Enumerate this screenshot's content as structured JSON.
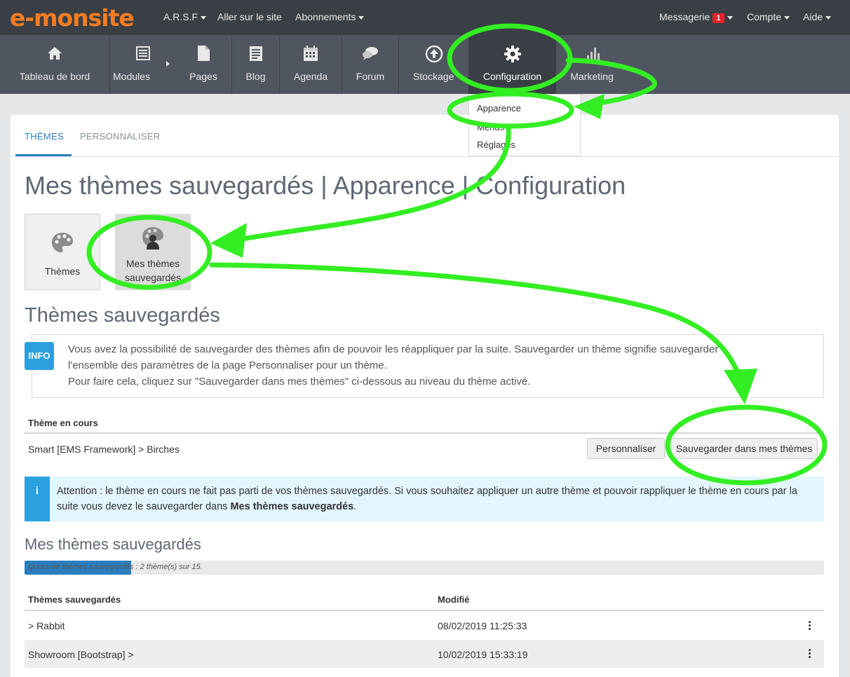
{
  "topbar": {
    "logo": "e-monsite",
    "site_menu": "A.R.S.F",
    "visit_site": "Aller sur le site",
    "subscriptions": "Abonnements",
    "messaging": "Messagerie",
    "messaging_count": "1",
    "account": "Compte",
    "help": "Aide"
  },
  "nav": {
    "dashboard": "Tableau de bord",
    "modules": "Modules",
    "pages": "Pages",
    "blog": "Blog",
    "agenda": "Agenda",
    "forum": "Forum",
    "storage": "Stockage",
    "configuration": "Configuration",
    "marketing": "Marketing"
  },
  "dropdown": {
    "items": [
      "Apparence",
      "Menus",
      "Réglages"
    ]
  },
  "tabs": {
    "themes": "THÈMES",
    "customize": "PERSONNALISER"
  },
  "page_title": "Mes thèmes sauvegardés | Apparence | Configuration",
  "tiles": {
    "themes": "Thèmes",
    "saved_line1": "Mes thèmes",
    "saved_line2": "sauvegardés"
  },
  "section_title": "Thèmes sauvegardés",
  "info": {
    "tag": "INFO",
    "line1": "Vous avez la possibilité de sauvegarder des thèmes afin de pouvoir les réappliquer par la suite. Sauvegarder un thème signifie sauvegarder",
    "line2": "l'ensemble des paramètres de la page Personnaliser pour un thème.",
    "line3": "Pour faire cela, cliquez sur \"Sauvegarder dans mes thèmes\" ci-dessous au niveau du thème activé."
  },
  "current_theme": {
    "header": "Thème en cours",
    "name": "Smart [EMS Framework] > Birches",
    "customize_button": "Personnaliser",
    "save_button": "Sauvegarder dans mes thèmes"
  },
  "alert": {
    "icon": "i",
    "text_part1": "Attention : le thème en cours ne fait pas parti de vos thèmes sauvegardés. Si vous souhaitez appliquer un autre thème et pouvoir rappliquer le thème en cours par la suite vous devez le sauvegarder dans ",
    "text_bold": "Mes thèmes sauvegardés",
    "text_part2": "."
  },
  "saved_section_title": "Mes thèmes sauvegardés",
  "quota": {
    "text": "Quota de thèmes sauvegardés : 2 thème(s) sur 15.",
    "fraction": 0.1333
  },
  "table": {
    "col1": "Thèmes sauvegardés",
    "col2": "Modifié",
    "rows": [
      {
        "name": "> Rabbit",
        "modified": "08/02/2019 11:25:33"
      },
      {
        "name": "Showroom [Bootstrap] >",
        "modified": "10/02/2019 15:33:19"
      }
    ]
  },
  "colors": {
    "topbar": "#3a3f46",
    "nav": "#50565f",
    "logo": "#f47c20",
    "accent": "#2b7fc0",
    "info": "#2aa1de",
    "annotation": "#33ee22"
  }
}
